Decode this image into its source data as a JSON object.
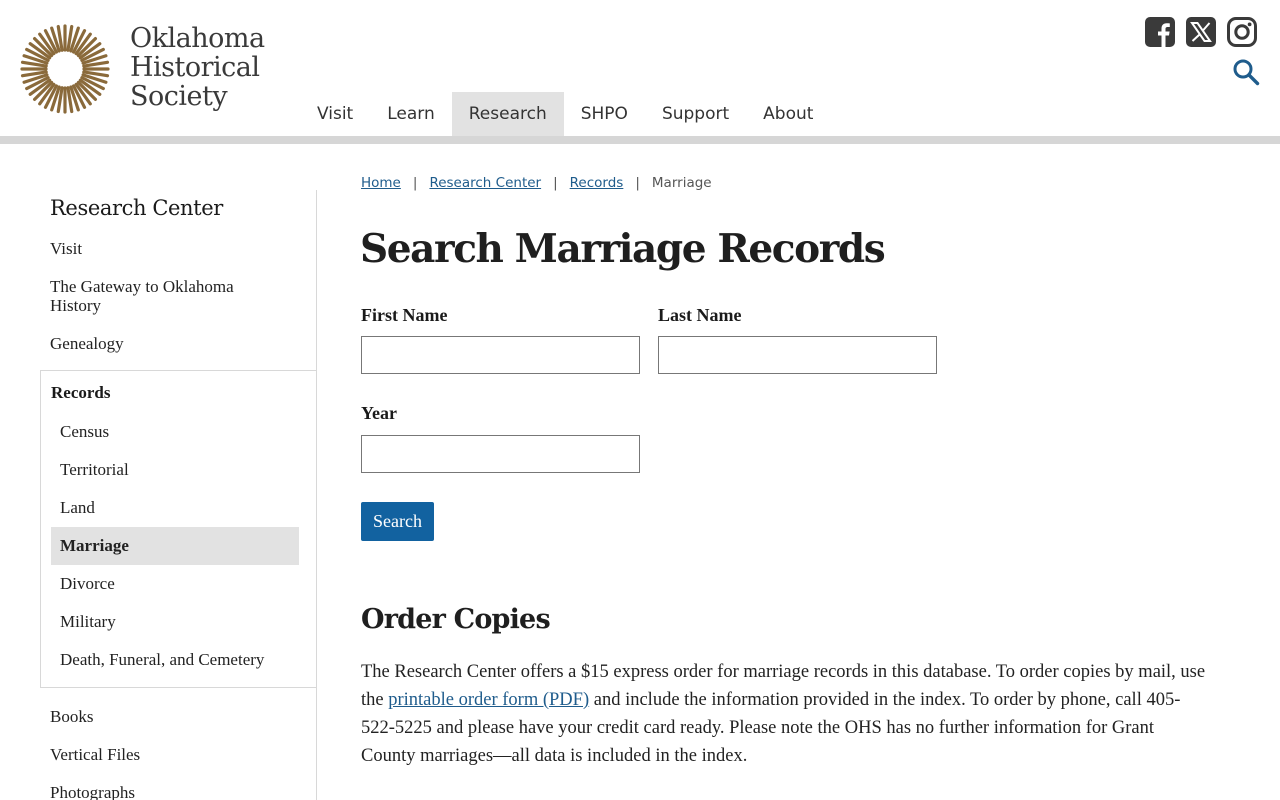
{
  "header": {
    "logo_lines": [
      "Oklahoma",
      "Historical",
      "Society"
    ],
    "nav": [
      {
        "label": "Visit",
        "active": false
      },
      {
        "label": "Learn",
        "active": false
      },
      {
        "label": "Research",
        "active": true
      },
      {
        "label": "SHPO",
        "active": false
      },
      {
        "label": "Support",
        "active": false
      },
      {
        "label": "About",
        "active": false
      }
    ],
    "social_icons": [
      "facebook-icon",
      "x-icon",
      "instagram-icon"
    ],
    "search_icon": "search-icon"
  },
  "colors": {
    "accent_blue": "#1262a0",
    "link_blue": "#1f5c8c",
    "logo_brown": "#8a6a3b",
    "nav_active_bg": "#e2e2e2"
  },
  "sidebar": {
    "title": "Research Center",
    "items_top": [
      "Visit",
      "The Gateway to Oklahoma History",
      "Genealogy"
    ],
    "records": {
      "title": "Records",
      "items": [
        {
          "label": "Census",
          "active": false
        },
        {
          "label": "Territorial",
          "active": false
        },
        {
          "label": "Land",
          "active": false
        },
        {
          "label": "Marriage",
          "active": true
        },
        {
          "label": "Divorce",
          "active": false
        },
        {
          "label": "Military",
          "active": false
        },
        {
          "label": "Death, Funeral, and Cemetery",
          "active": false
        }
      ]
    },
    "items_bottom": [
      "Books",
      "Vertical Files",
      "Photographs"
    ]
  },
  "breadcrumb": {
    "links": [
      "Home",
      "Research Center",
      "Records"
    ],
    "current": "Marriage",
    "separator": "|"
  },
  "main": {
    "title": "Search Marriage Records",
    "form": {
      "first_name_label": "First Name",
      "first_name_value": "",
      "last_name_label": "Last Name",
      "last_name_value": "",
      "year_label": "Year",
      "year_value": "",
      "search_button": "Search"
    },
    "order": {
      "title": "Order Copies",
      "text_1": "The Research Center offers a $15 express order for marriage records in this database. To order copies by mail, use the ",
      "link": "printable order form (PDF)",
      "text_2": " and include the information provided in the index. To order by phone, call 405-522-5225 and please have your credit card ready. Please note the OHS has no further information for Grant County marriages—all data is included in the index."
    }
  }
}
